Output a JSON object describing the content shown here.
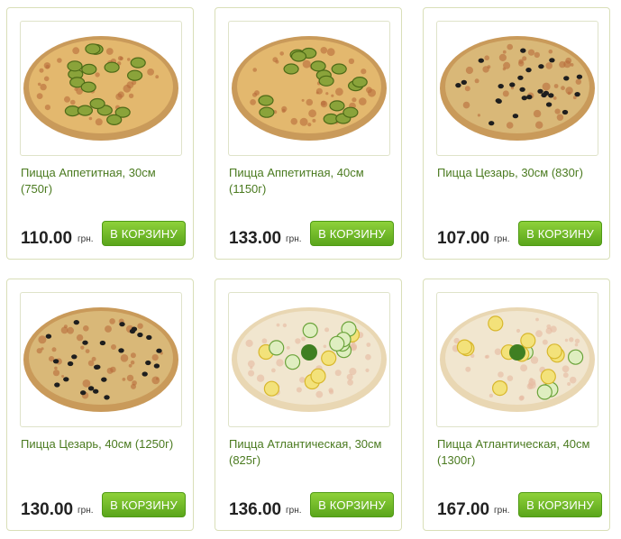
{
  "products": [
    {
      "title": "Пицца Аппетитная, 30см (750г)",
      "price": "110.00",
      "currency": "грн.",
      "button": "В КОРЗИНУ",
      "image": "pizza-pickles"
    },
    {
      "title": "Пицца Аппетитная, 40см (1150г)",
      "price": "133.00",
      "currency": "грн.",
      "button": "В КОРЗИНУ",
      "image": "pizza-pickles"
    },
    {
      "title": "Пицца Цезарь, 30см (830г)",
      "price": "107.00",
      "currency": "грн.",
      "button": "В КОРЗИНУ",
      "image": "pizza-olives"
    },
    {
      "title": "Пицца Цезарь, 40см (1250г)",
      "price": "130.00",
      "currency": "грн.",
      "button": "В КОРЗИНУ",
      "image": "pizza-olives"
    },
    {
      "title": "Пицца Атлантическая, 30см (825г)",
      "price": "136.00",
      "currency": "грн.",
      "button": "В КОРЗИНУ",
      "image": "pizza-lemon"
    },
    {
      "title": "Пицца Атлантическая, 40см (1300г)",
      "price": "167.00",
      "currency": "грн.",
      "button": "В КОРЗИНУ",
      "image": "pizza-lemon"
    }
  ],
  "colors": {
    "title": "#4a7a1f",
    "button_top": "#8ed13a",
    "button_bottom": "#5aa51b",
    "border": "#d9dfb8"
  }
}
